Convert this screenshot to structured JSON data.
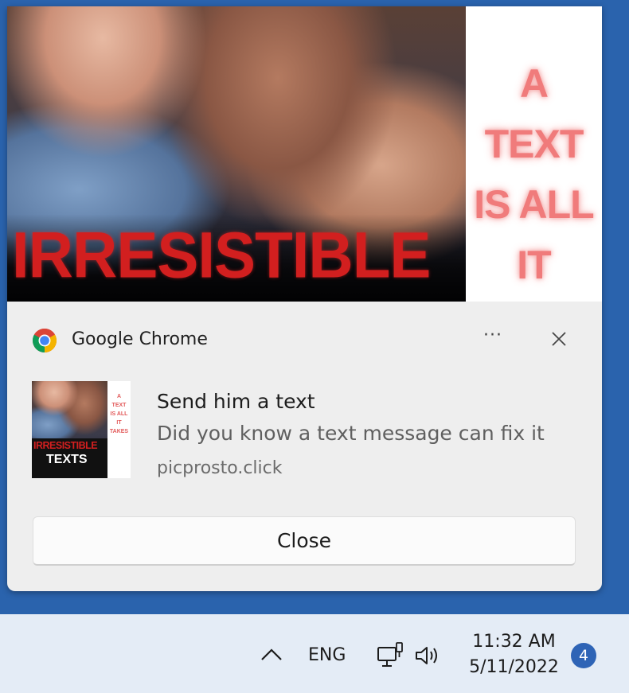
{
  "notification": {
    "hero": {
      "title": "IRRESISTIBLE",
      "side_lines": [
        "A",
        "TEXT",
        "IS ALL",
        "IT"
      ]
    },
    "app_name": "Google Chrome",
    "more_label": "···",
    "thumbnail": {
      "line1": "IRRESISTIBLE",
      "line2": "TEXTS",
      "side_lines": [
        "A",
        "TEXT",
        "IS ALL",
        "IT",
        "TAKES"
      ]
    },
    "title": "Send him a text",
    "body": "Did you know a text message can fix it",
    "source": "picprosto.click",
    "action_label": "Close"
  },
  "taskbar": {
    "language": "ENG",
    "time": "11:32 AM",
    "date": "5/11/2022",
    "notification_count": "4"
  },
  "icons": {
    "chrome": "chrome-logo-icon",
    "more": "more-options-icon",
    "close": "close-icon",
    "chevron": "chevron-up-icon",
    "network": "network-icon",
    "volume": "volume-icon"
  },
  "colors": {
    "desktop": "#2a63ad",
    "toast_bg": "#eeeeee",
    "hero_text": "#d21f1f",
    "hero_side_text": "#f07b7b",
    "taskbar_bg": "#e4ecf6",
    "badge_bg": "#2e64b6"
  }
}
